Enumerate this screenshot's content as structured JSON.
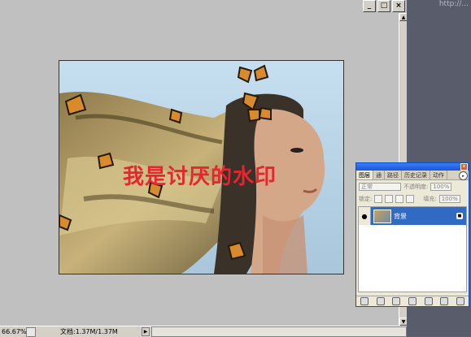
{
  "window": {
    "minimize_label": "_",
    "restore_label": "□",
    "close_label": "×"
  },
  "watermark_overlay": "我是讨厌的水印",
  "corner_watermark": "http://...",
  "statusbar": {
    "zoom": "66.67%",
    "doc_size": "文档:1.37M/1.37M"
  },
  "layers_panel": {
    "close_label": "x",
    "tabs": [
      "图层",
      "通",
      "路径",
      "历史记录",
      "动作"
    ],
    "blend_mode": "正常",
    "opacity_label": "不透明度:",
    "opacity_value": "100%",
    "lock_label": "锁定:",
    "fill_label": "填充:",
    "fill_value": "100%",
    "layer": {
      "name": "背景"
    }
  },
  "colors": {
    "workspace": "#c0c0c0",
    "selection": "#316ac5",
    "watermark": "#e8242e"
  }
}
